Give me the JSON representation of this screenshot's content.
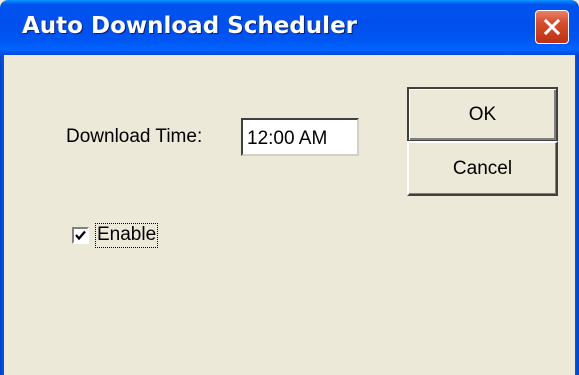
{
  "window": {
    "title": "Auto Download Scheduler",
    "title_bar_color": "#0054e3",
    "body_color": "#ece9d8",
    "close_color": "#d5502f"
  },
  "form": {
    "download_time_label": "Download Time:",
    "download_time_value": "12:00 AM",
    "enable_label": "Enable",
    "enable_checked": true
  },
  "buttons": {
    "ok_label": "OK",
    "cancel_label": "Cancel"
  },
  "icons": {
    "close": "close-icon",
    "check": "check-icon"
  }
}
